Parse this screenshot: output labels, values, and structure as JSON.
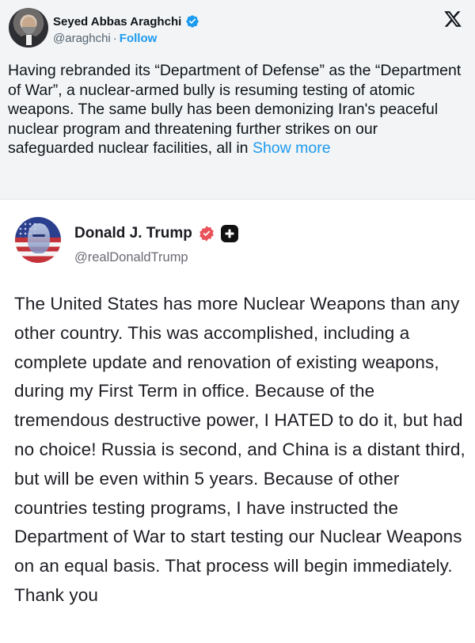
{
  "tweet": {
    "author_name": "Seyed Abbas Araghchi",
    "handle": "@araghchi",
    "separator": "·",
    "follow_label": "Follow",
    "text": "Having rebranded its “Department of Defense” as the “Department of War”, a nuclear-armed bully is resuming testing of atomic weapons. The same bully has been demonizing Iran's peaceful nuclear program and threatening further strikes on our safeguarded nuclear facilities, all in ",
    "show_more_label": "Show more",
    "icons": {
      "avatar": "profile-photo",
      "verified": "verified-badge-icon",
      "platform": "x-logo-icon"
    },
    "colors": {
      "link": "#1d9bf0",
      "background": "#f2f4f5",
      "text": "#0f1419",
      "muted": "#536471"
    }
  },
  "embedded_post": {
    "author_name": "Donald J. Trump",
    "handle": "@realDonaldTrump",
    "text": "The United States has more Nuclear Weapons than any other country. This was accomplished, including a complete update and renovation of existing weapons, during my First Term in office. Because of the tremendous destructive power, I HATED to do it, but had no choice! Russia is second, and China is a distant third, but will be even within 5 years. Because of other countries testing programs, I have instructed the Department of War to start testing our Nuclear Weapons on an equal basis. That process will begin immediately. Thank you",
    "icons": {
      "avatar": "profile-photo-flag",
      "verified": "verified-badge-icon",
      "follow": "plus-icon"
    },
    "colors": {
      "badge": "#e8525a",
      "background": "#ffffff"
    }
  }
}
